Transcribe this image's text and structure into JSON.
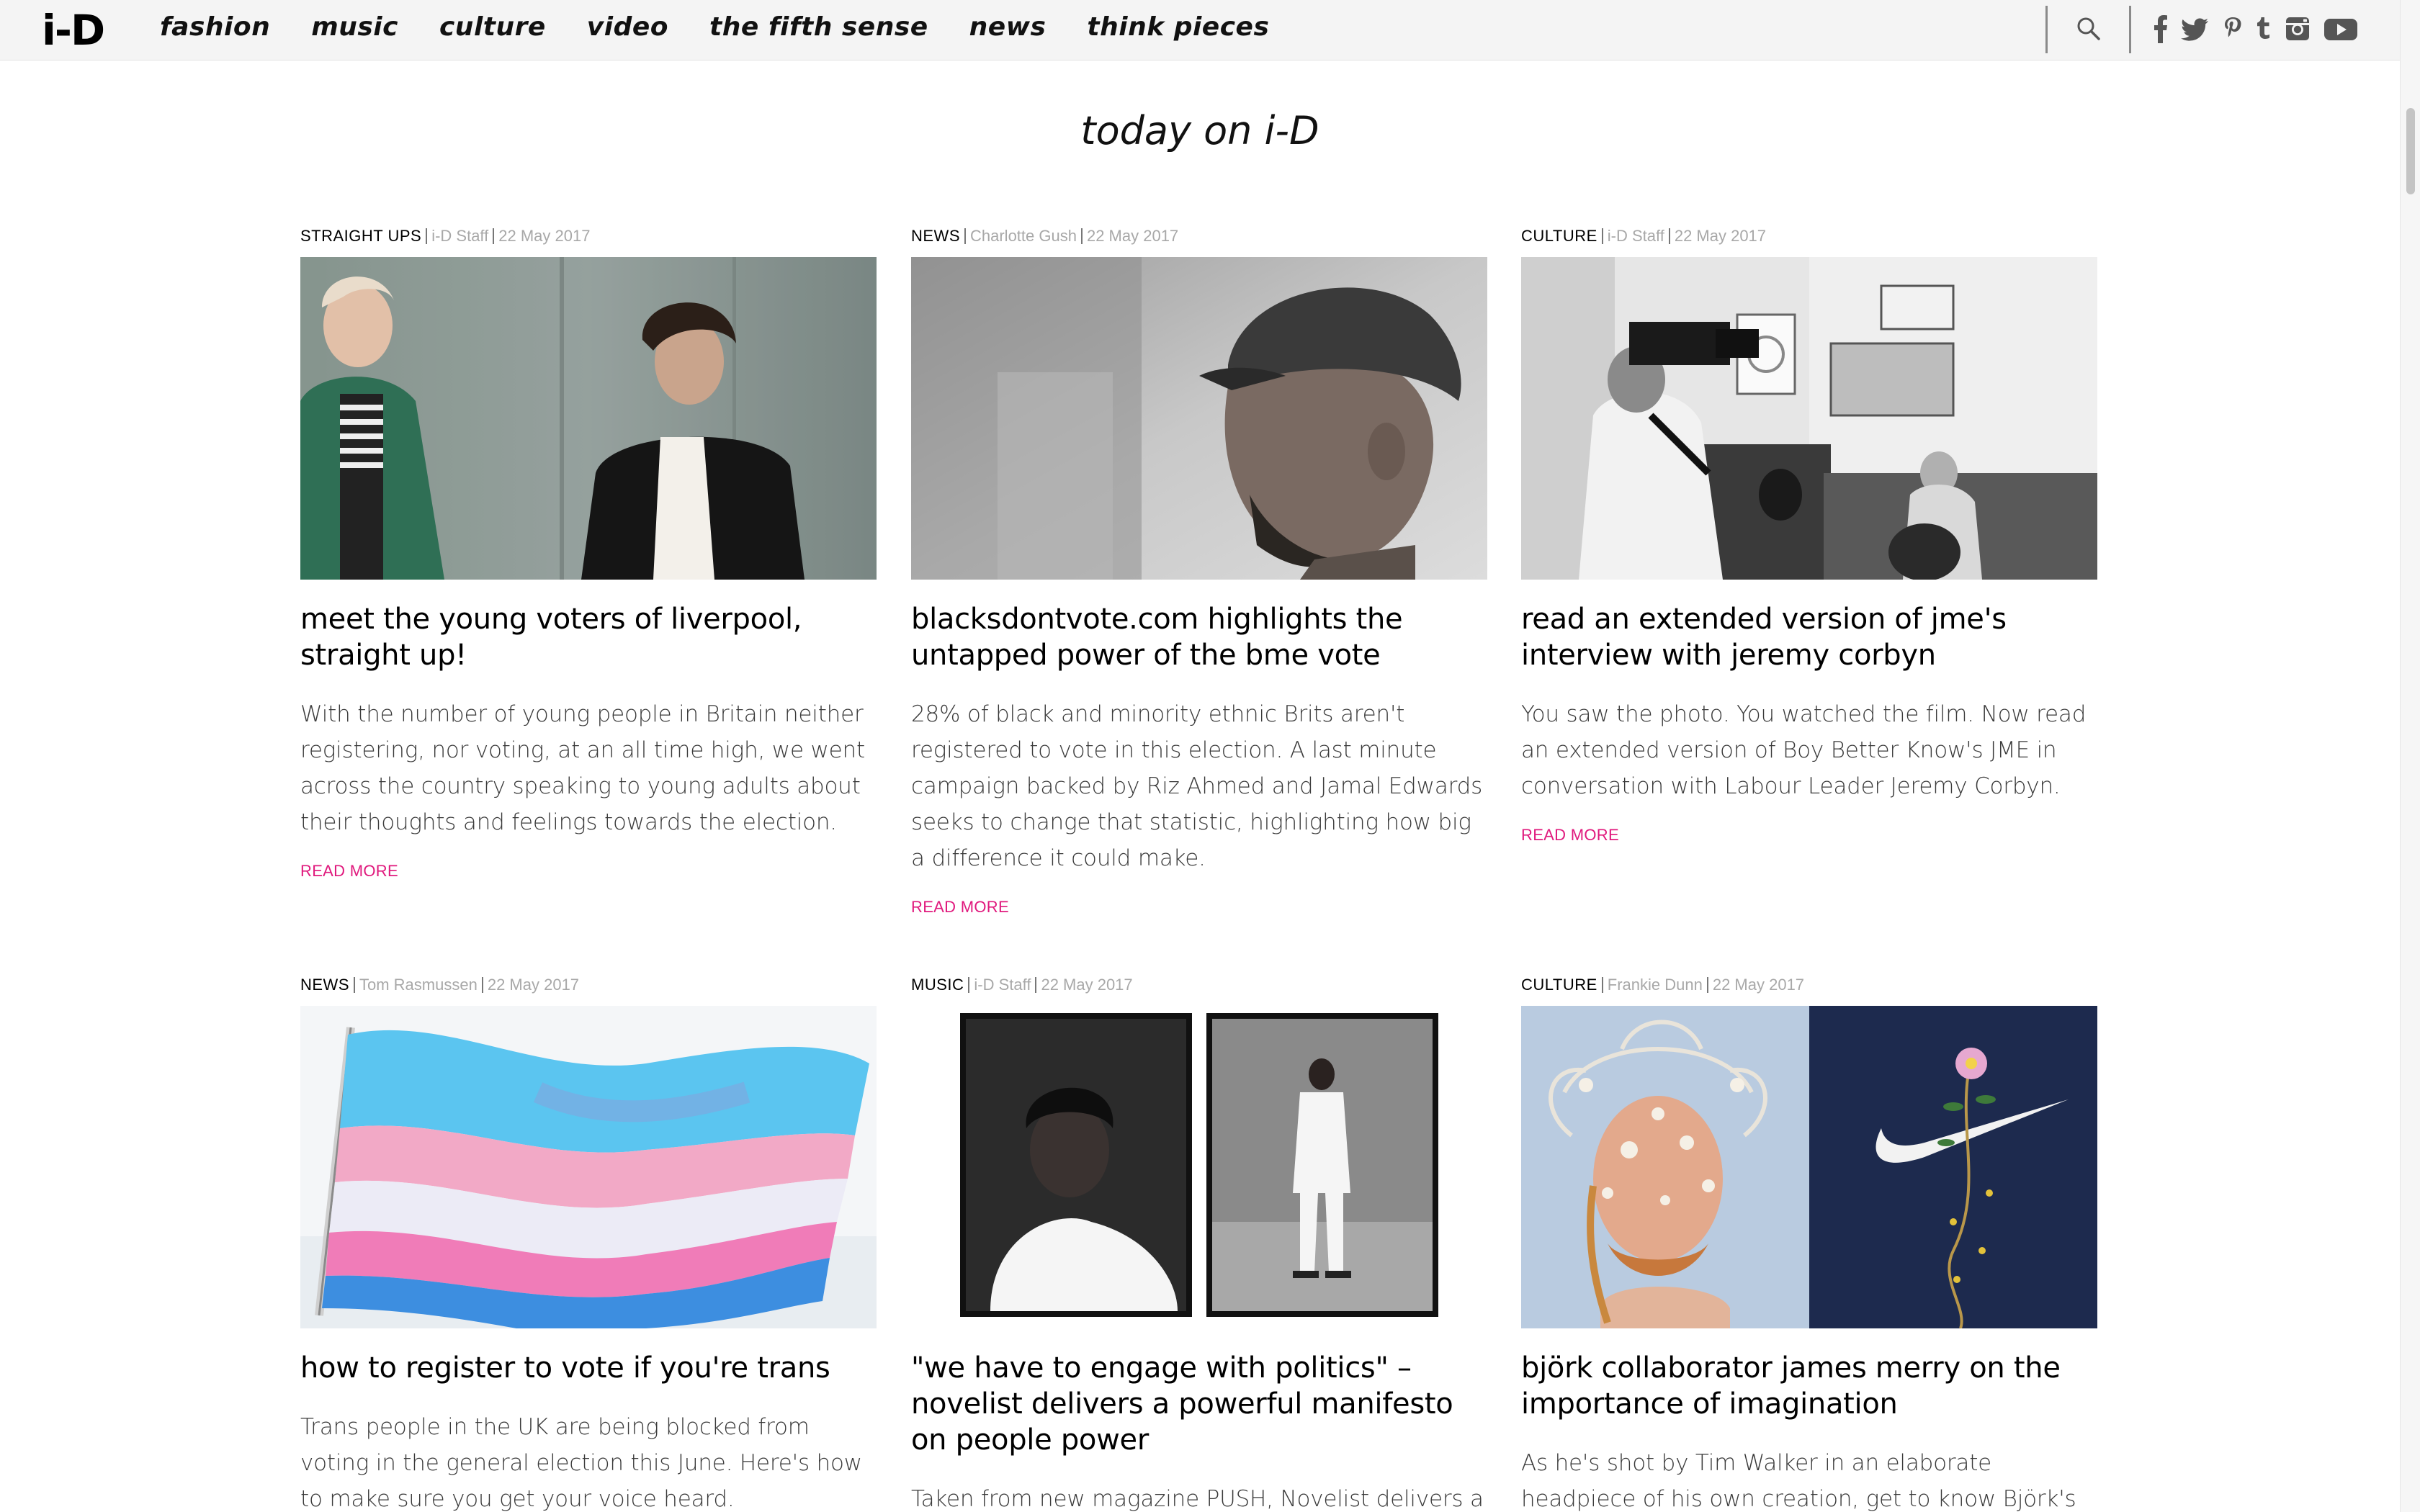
{
  "header": {
    "logo": "i-D",
    "nav": [
      "fashion",
      "music",
      "culture",
      "video",
      "the fifth sense",
      "news",
      "think pieces"
    ],
    "social": [
      "facebook-icon",
      "twitter-icon",
      "pinterest-icon",
      "tumblr-icon",
      "instagram-icon",
      "youtube-icon"
    ]
  },
  "section_title": "today on i-D",
  "read_more_label": "READ MORE",
  "colors": {
    "accent": "#e0197d",
    "meta_gray": "#a8a8a8",
    "nav_bg": "#f4f4f4"
  },
  "articles": [
    {
      "category": "STRAIGHT UPS",
      "author": "i-D Staff",
      "date": "22 May 2017",
      "title": "meet the young voters of liverpool, straight up!",
      "excerpt": "With the number of young people in Britain neither registering, nor voting, at an all time high, we went across the country speaking to young adults about their thoughts and feelings towards the election."
    },
    {
      "category": "NEWS",
      "author": "Charlotte Gush",
      "date": "22 May 2017",
      "title": "blacksdontvote.com highlights the untapped power of the bme vote",
      "excerpt": "28% of black and minority ethnic Brits aren't registered to vote in this election. A last minute campaign backed by Riz Ahmed and Jamal Edwards seeks to change that statistic, highlighting how big a difference it could make."
    },
    {
      "category": "CULTURE",
      "author": "i-D Staff",
      "date": "22 May 2017",
      "title": "read an extended version of jme's interview with jeremy corbyn",
      "excerpt": "You saw the photo. You watched the film. Now read an extended version of Boy Better Know's JME in conversation with Labour Leader Jeremy Corbyn."
    },
    {
      "category": "NEWS",
      "author": "Tom Rasmussen",
      "date": "22 May 2017",
      "title": "how to register to vote if you're trans",
      "excerpt": "Trans people in the UK are being blocked from voting in the general election this June. Here's how to make sure you get your voice heard."
    },
    {
      "category": "MUSIC",
      "author": "i-D Staff",
      "date": "22 May 2017",
      "title": "\"we have to engage with politics\" – novelist delivers a powerful manifesto on people power",
      "excerpt": "Taken from new magazine PUSH, Novelist delivers a"
    },
    {
      "category": "CULTURE",
      "author": "Frankie Dunn",
      "date": "22 May 2017",
      "title": "björk collaborator james merry on the importance of imagination",
      "excerpt": "As he's shot by Tim Walker in an elaborate headpiece of his own creation, get to know Björk's co-creative"
    }
  ]
}
